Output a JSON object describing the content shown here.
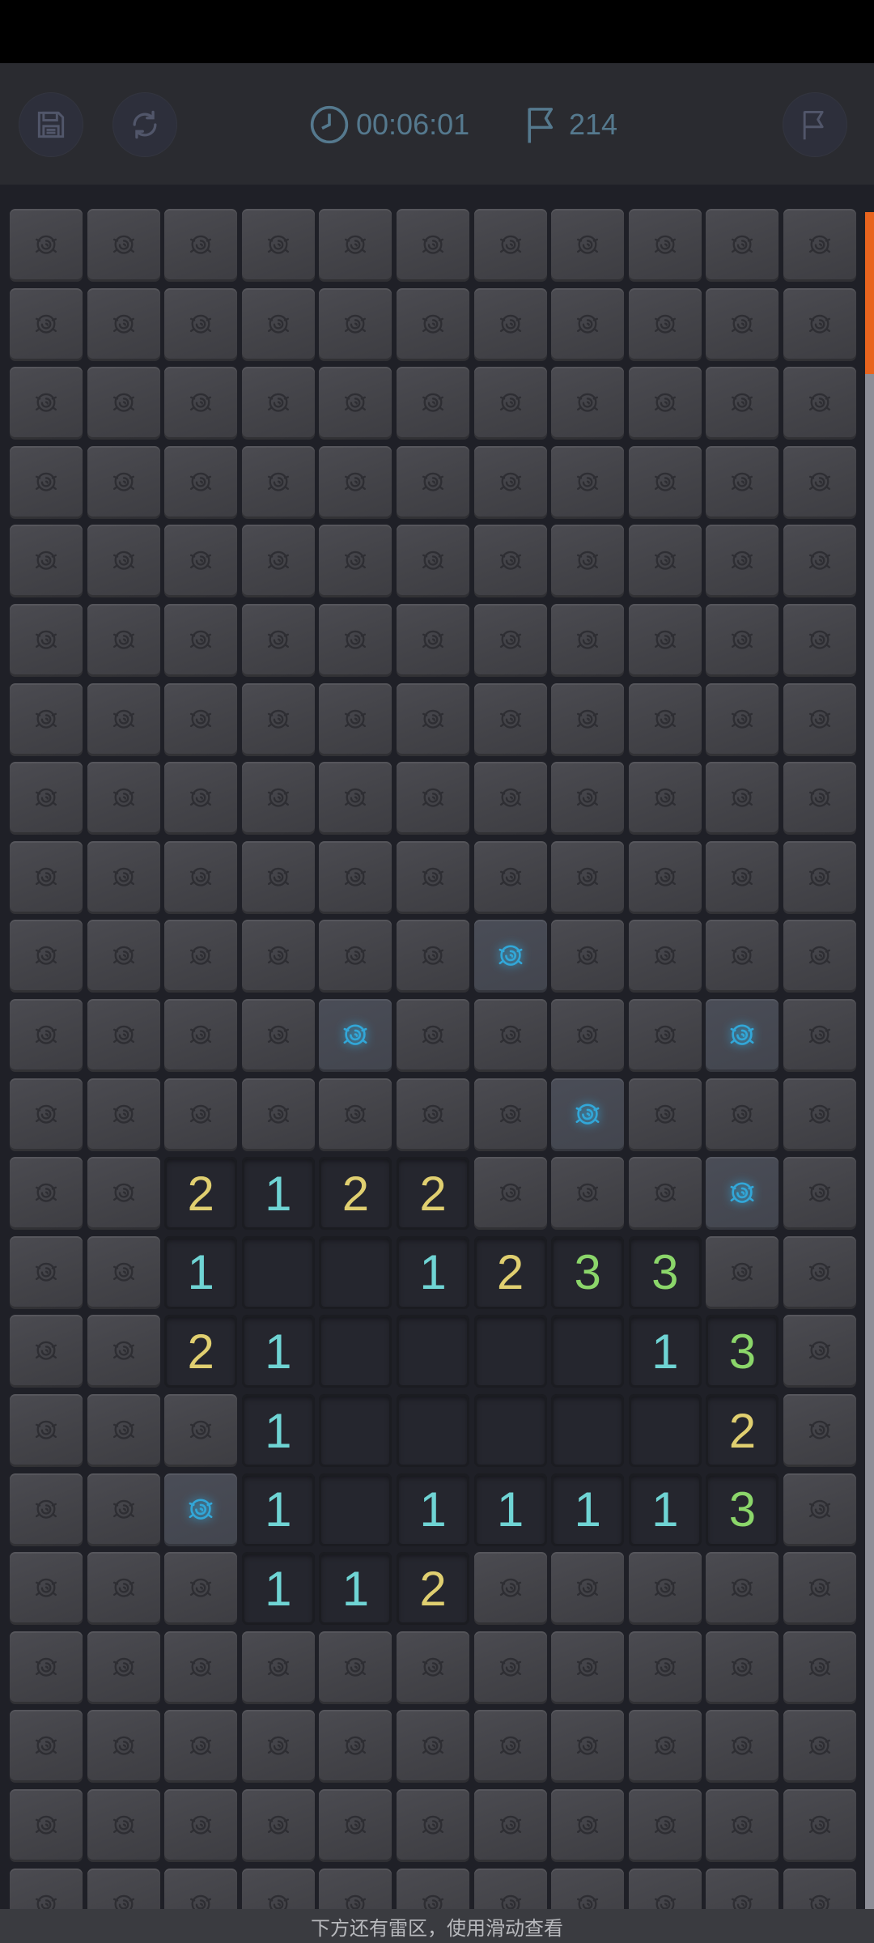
{
  "header": {
    "timer": "00:06:01",
    "mines_left": "214"
  },
  "board": {
    "cols": 11,
    "visible_rows": 22,
    "rows": [
      "HHHHHHHHHHH",
      "HHHHHHHHHHH",
      "HHHHHHHHHHH",
      "HHHHHHHHHHH",
      "HHHHHHHHHHH",
      "HHHHHHHHHHH",
      "HHHHHHHHHHH",
      "HHHHHHHHHHH",
      "HHHHHHHHHHH",
      "HHHHHHGHHHH",
      "HHHHGHHHHGH",
      "HHHHHHHGHHH",
      "HH2122HHHGH",
      "HH1__1233HH",
      "HH21____13H",
      "HHH1_____2H",
      "HHG1_11113H",
      "HHH112HHHHH",
      "HHHHHHHHHHH",
      "HHHHHHHHHHH",
      "HHHHHHHHHHH",
      "HHHHHHHHHHH"
    ],
    "legend": {
      "H": "hidden",
      "G": "hint-highlighted hidden",
      "_": "empty revealed",
      "1-3": "adjacent mine count"
    }
  },
  "colors": {
    "number_1": "#6fd4d4",
    "number_2": "#e0cf70",
    "number_3": "#8bd66a",
    "glow": "#2fb8f0",
    "scroll_thumb": "#e8641e"
  },
  "scroll": {
    "position_fraction": 0.0
  },
  "footer": {
    "hint": "下方还有雷区，使用滑动查看"
  }
}
